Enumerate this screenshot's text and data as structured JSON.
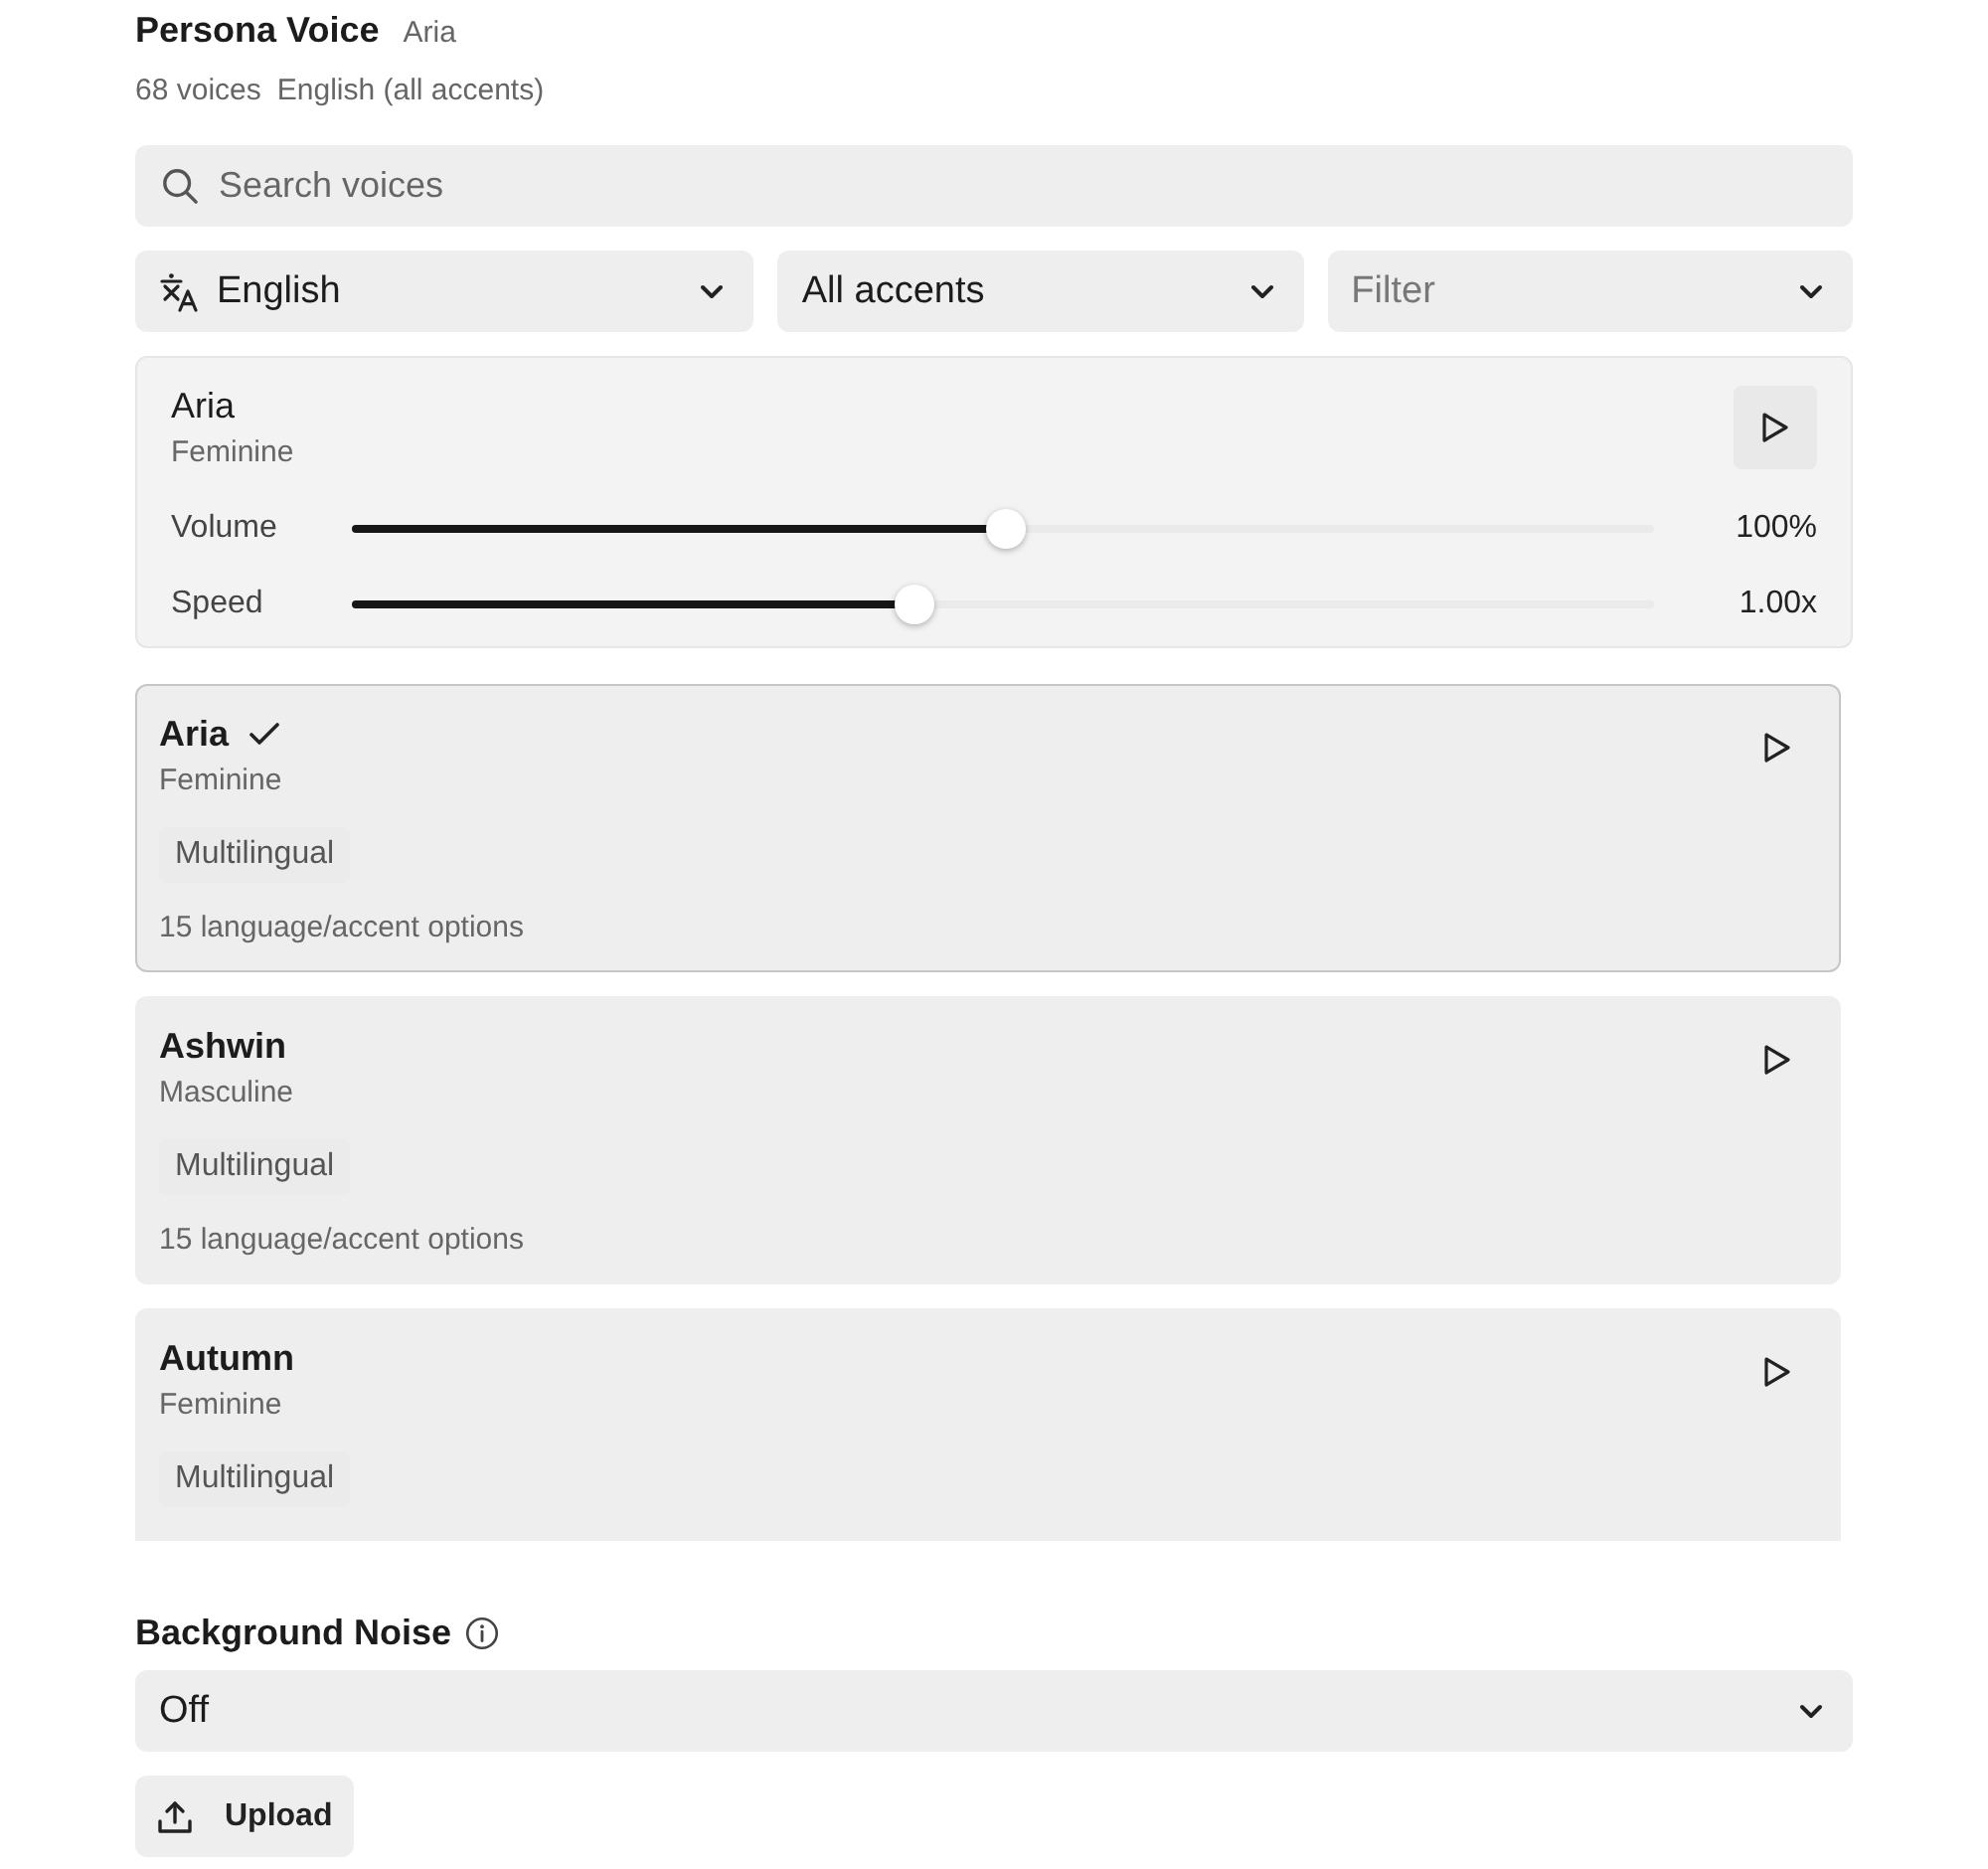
{
  "header": {
    "title": "Persona Voice",
    "current_voice": "Aria",
    "voice_count": "68 voices",
    "language_summary": "English (all accents)"
  },
  "search": {
    "placeholder": "Search voices"
  },
  "filters": [
    {
      "kind": "language",
      "value": "English"
    },
    {
      "kind": "accent",
      "value": "All accents"
    },
    {
      "kind": "filter",
      "placeholder": "Filter"
    }
  ],
  "player": {
    "name": "Aria",
    "gender": "Feminine",
    "sliders": [
      {
        "label": "Volume",
        "level": 0.502,
        "reading": "100%"
      },
      {
        "label": "Speed",
        "level": 0.43,
        "reading": "1.00x"
      }
    ]
  },
  "voices": [
    {
      "name": "Aria",
      "gender": "Feminine",
      "tag": "Multilingual",
      "options": "15 language/accent options",
      "selected": true
    },
    {
      "name": "Ashwin",
      "gender": "Masculine",
      "tag": "Multilingual",
      "options": "15 language/accent options",
      "selected": false
    },
    {
      "name": "Autumn",
      "gender": "Feminine",
      "tag": "Multilingual",
      "selected": false
    }
  ],
  "background_noise": {
    "label": "Background Noise",
    "value": "Off",
    "upload_button": "Upload"
  }
}
